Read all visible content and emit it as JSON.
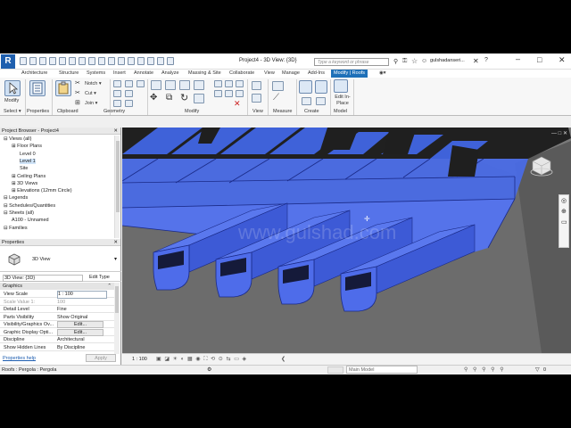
{
  "title_bar": {
    "app_logo": "R",
    "document_title": "Project4 - 3D View: {3D}",
    "search_placeholder": "Type a keyword or phrase",
    "user_name": "gulshadanseri...",
    "help_label": "?"
  },
  "tabs": [
    "Architecture",
    "Structure",
    "Systems",
    "Insert",
    "Annotate",
    "Analyze",
    "Massing & Site",
    "Collaborate",
    "View",
    "Manage",
    "Add-Ins",
    "Modify | Roofs"
  ],
  "ribbon": {
    "select": {
      "big": "Modify",
      "label": "Select ▾"
    },
    "properties": {
      "label": "Properties"
    },
    "clipboard": {
      "items": [
        "Notch ▾",
        "Cut ▾",
        "Join ▾"
      ],
      "label": "Clipboard"
    },
    "geometry": {
      "label": "Geometry"
    },
    "modify": {
      "label": "Modify"
    },
    "view": {
      "label": "View"
    },
    "measure": {
      "label": "Measure"
    },
    "create": {
      "label": "Create"
    },
    "model": {
      "big": "Edit In-Place",
      "label": "Model"
    }
  },
  "project_browser": {
    "title": "Project Browser - Project4",
    "items": [
      {
        "text": "Views (all)",
        "level": 0
      },
      {
        "text": "Floor Plans",
        "level": 1
      },
      {
        "text": "Level 0",
        "level": 2
      },
      {
        "text": "Level 1",
        "level": 2
      },
      {
        "text": "Site",
        "level": 2
      },
      {
        "text": "Ceiling Plans",
        "level": 1
      },
      {
        "text": "3D Views",
        "level": 1
      },
      {
        "text": "Elevations (12mm Circle)",
        "level": 1
      },
      {
        "text": "Legends",
        "level": 0
      },
      {
        "text": "Schedules/Quantities",
        "level": 0
      },
      {
        "text": "Sheets (all)",
        "level": 0
      },
      {
        "text": "A100 - Unnamed",
        "level": 1
      },
      {
        "text": "Families",
        "level": 0
      }
    ]
  },
  "properties": {
    "title": "Properties",
    "type_name": "3D View",
    "instance_selector": "3D View: {3D}",
    "edit_type": "Edit Type",
    "group": "Graphics",
    "rows": [
      {
        "key": "View Scale",
        "value": "1 : 100"
      },
      {
        "key": "Scale Value  1:",
        "value": "100"
      },
      {
        "key": "Detail Level",
        "value": "Fine"
      },
      {
        "key": "Parts Visibility",
        "value": "Show Original"
      },
      {
        "key": "Visibility/Graphics Ov...",
        "value": "Edit..."
      },
      {
        "key": "Graphic Display Opti...",
        "value": "Edit..."
      },
      {
        "key": "Discipline",
        "value": "Architectural"
      },
      {
        "key": "Show Hidden Lines",
        "value": "By Discipline"
      }
    ],
    "help_link": "Properties help",
    "apply": "Apply"
  },
  "view_control_bar": {
    "scale": "1 : 100",
    "workset": "Main Model",
    "filter": "0"
  },
  "status_bar": {
    "text": "Roofs : Pergola : Pergola"
  },
  "watermark": "www.gulshad.com",
  "colors": {
    "accent": "#1e70b8",
    "selection_blue": "#4a6be6",
    "beam_dark": "#1a2a88"
  }
}
